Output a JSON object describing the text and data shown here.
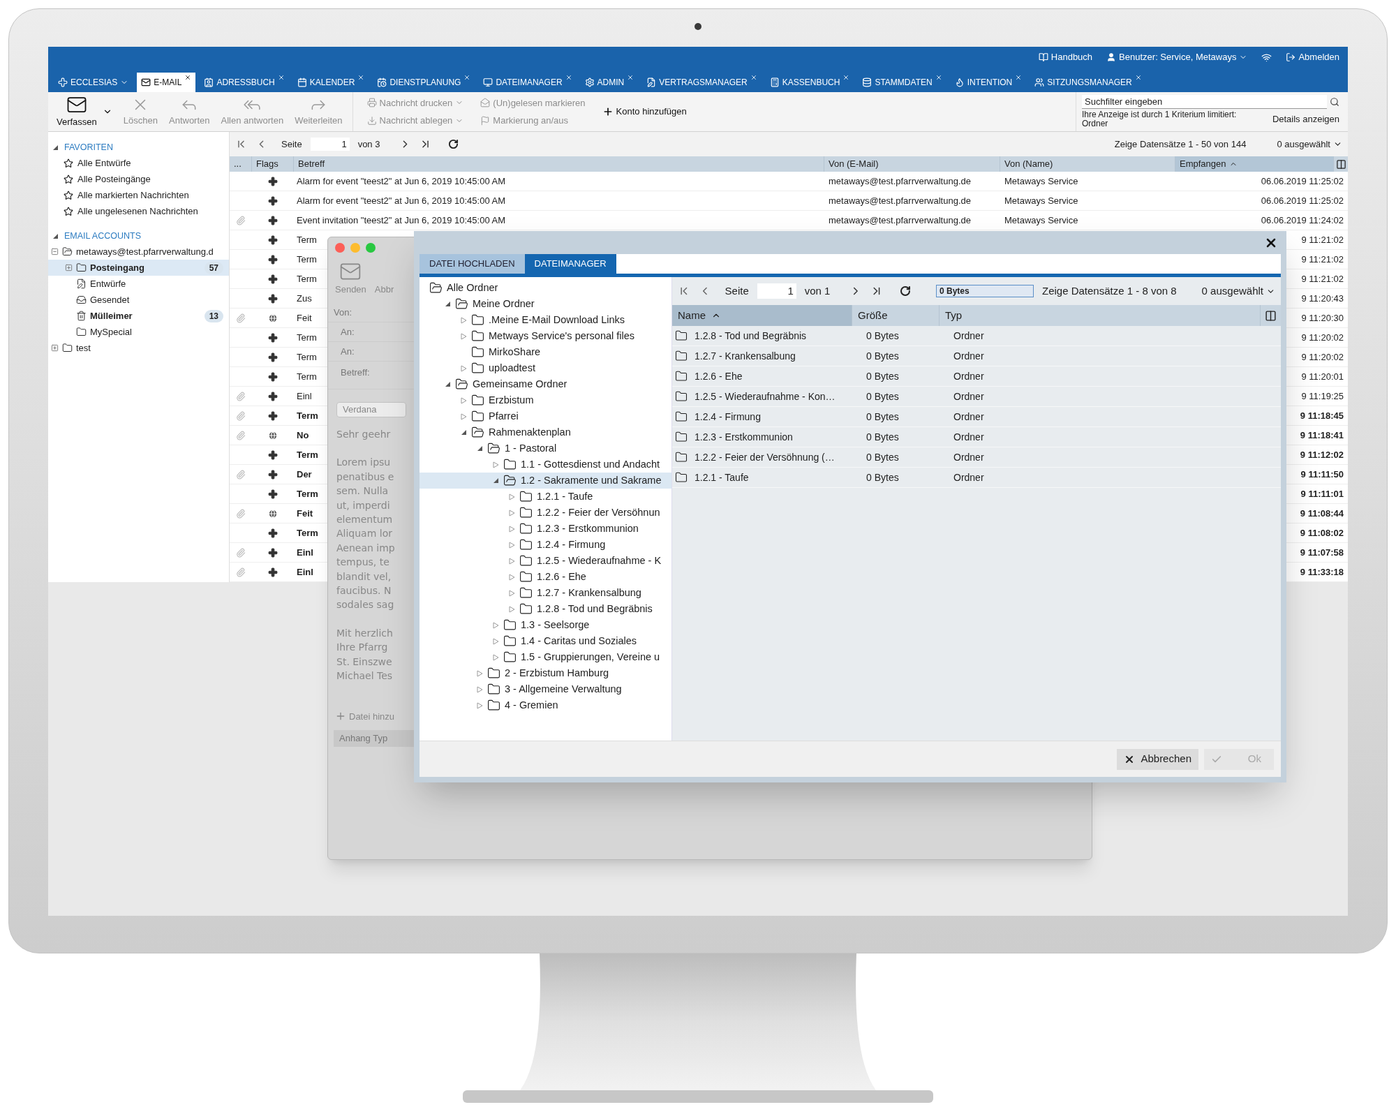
{
  "top_bar": {
    "user_links": [
      {
        "kind": "manual",
        "label": "Handbuch"
      },
      {
        "kind": "user",
        "label": "Benutzer: Service, Metaways"
      },
      {
        "kind": "logout",
        "label": "Abmelden"
      }
    ],
    "tabs": [
      {
        "kind": "menu",
        "label": "ECCLESIAS",
        "selected": false
      },
      {
        "kind": "app",
        "label": "E-MAIL",
        "selected": true
      },
      {
        "kind": "app",
        "label": "ADRESSBUCH",
        "selected": false
      },
      {
        "kind": "app",
        "label": "KALENDER",
        "selected": false
      },
      {
        "kind": "app",
        "label": "DIENSTPLANUNG",
        "selected": false
      },
      {
        "kind": "app",
        "label": "DATEIMANAGER",
        "selected": false
      },
      {
        "kind": "app",
        "label": "ADMIN",
        "selected": false
      },
      {
        "kind": "app",
        "label": "VERTRAGSMANAGER",
        "selected": false
      },
      {
        "kind": "app",
        "label": "KASSENBUCH",
        "selected": false
      },
      {
        "kind": "app",
        "label": "STAMMDATEN",
        "selected": false
      },
      {
        "kind": "app",
        "label": "INTENTION",
        "selected": false
      },
      {
        "kind": "app",
        "label": "SITZUNGSMANAGER",
        "selected": false
      }
    ]
  },
  "toolbar": {
    "buttons": [
      {
        "label": "Verfassen",
        "disabled": false,
        "dropdown": true
      },
      {
        "label": "Löschen",
        "disabled": true,
        "dropdown": false
      },
      {
        "label": "Antworten",
        "disabled": true,
        "dropdown": false
      },
      {
        "label": "Allen antworten",
        "disabled": true,
        "dropdown": false
      },
      {
        "label": "Weiterleiten",
        "disabled": true,
        "dropdown": false
      }
    ],
    "action_columns": [
      {
        "items": [
          {
            "label": "Nachricht drucken",
            "disabled": true,
            "dropdown": true
          },
          {
            "label": "Nachricht ablegen",
            "disabled": true,
            "dropdown": true
          }
        ]
      },
      {
        "items": [
          {
            "label": "(Un)gelesen markieren",
            "disabled": true,
            "dropdown": false
          },
          {
            "label": "Markierung an/aus",
            "disabled": true,
            "dropdown": false
          }
        ]
      },
      {
        "items": [
          {
            "label": "Konto hinzufügen",
            "disabled": false,
            "dropdown": false
          }
        ]
      }
    ],
    "search": {
      "placeholder": "Suchfilter eingeben"
    },
    "filter_note": "Ihre Anzeige ist durch 1 Kriterium limitiert: Ordner",
    "details_button": "Details anzeigen"
  },
  "sidebar": {
    "favorites": {
      "title": "FAVORITEN",
      "expanded": true,
      "items": [
        {
          "label": "Alle Entwürfe"
        },
        {
          "label": "Alle Posteingänge"
        },
        {
          "label": "Alle markierten Nachrichten"
        },
        {
          "label": "Alle ungelesenen Nachrichten"
        }
      ]
    },
    "accounts": {
      "title": "EMAIL ACCOUNTS",
      "expanded": true,
      "tree": [
        {
          "kind": "account",
          "label": "metaways@test.pfarrverwaltung.d",
          "expanded": true,
          "selected": false,
          "unread": false,
          "children": [
            {
              "kind": "folder",
              "label": "Posteingang",
              "expanded": false,
              "selected": true,
              "unread": true,
              "count": "57"
            },
            {
              "kind": "drafts",
              "label": "Entwürfe",
              "selected": false,
              "unread": false
            },
            {
              "kind": "sent",
              "label": "Gesendet",
              "selected": false,
              "unread": false
            },
            {
              "kind": "trash",
              "label": "Mülleimer",
              "selected": false,
              "unread": true,
              "count": "13"
            },
            {
              "kind": "folder",
              "label": "MySpecial",
              "selected": false,
              "unread": false
            }
          ]
        },
        {
          "kind": "folder",
          "label": "test",
          "expanded": false,
          "selected": false,
          "unread": false
        }
      ]
    }
  },
  "mail_list": {
    "pager": {
      "page_label": "Seite",
      "page": "1",
      "of": "von 3",
      "summary": "Zeige Datensätze 1 - 50 von 144",
      "selection": "0 ausgewählt"
    },
    "columns": [
      {
        "label": "...",
        "sorted": false
      },
      {
        "label": "Flags",
        "sorted": false
      },
      {
        "label": "Betreff",
        "sorted": false
      },
      {
        "label": "Von (E-Mail)",
        "sorted": false
      },
      {
        "label": "Von (Name)",
        "sorted": false
      },
      {
        "label": "Empfangen",
        "sorted": true
      }
    ],
    "rows": [
      {
        "subject": "Alarm for event \"teest2\" at Jun 6, 2019 10:45:00 AM",
        "email": "metaways@test.pfarrverwaltung.de",
        "name": "Metaways Service",
        "received": "06.06.2019 11:25:02",
        "unread": false,
        "attachment": false,
        "kind": "cross"
      },
      {
        "subject": "Alarm for event \"teest2\" at Jun 6, 2019 10:45:00 AM",
        "email": "metaways@test.pfarrverwaltung.de",
        "name": "Metaways Service",
        "received": "06.06.2019 11:25:02",
        "unread": false,
        "attachment": false,
        "kind": "cross"
      },
      {
        "subject": "Event invitation \"teest2\" at Jun 6, 2019 10:45:00 AM",
        "email": "metaways@test.pfarrverwaltung.de",
        "name": "Metaways Service",
        "received": "06.06.2019 11:24:02",
        "unread": false,
        "attachment": true,
        "kind": "cross"
      },
      {
        "subject": "Term",
        "received": "9 11:21:02",
        "unread": false,
        "attachment": false,
        "kind": "cross"
      },
      {
        "subject": "Term",
        "received": "9 11:21:02",
        "unread": false,
        "attachment": false,
        "kind": "cross"
      },
      {
        "subject": "Term",
        "received": "9 11:21:02",
        "unread": false,
        "attachment": false,
        "kind": "cross"
      },
      {
        "subject": "Zus",
        "received": "9 11:20:43",
        "unread": false,
        "attachment": false,
        "kind": "cross"
      },
      {
        "subject": "Feit",
        "received": "9 11:20:30",
        "unread": false,
        "attachment": true,
        "kind": "globe"
      },
      {
        "subject": "Term",
        "received": "9 11:20:02",
        "unread": false,
        "attachment": false,
        "kind": "cross"
      },
      {
        "subject": "Term",
        "received": "9 11:20:02",
        "unread": false,
        "attachment": false,
        "kind": "cross"
      },
      {
        "subject": "Term",
        "received": "9 11:20:01",
        "unread": false,
        "attachment": false,
        "kind": "cross"
      },
      {
        "subject": "Einl",
        "received": "9 11:19:25",
        "unread": false,
        "attachment": true,
        "kind": "cross"
      },
      {
        "subject": "Term",
        "received": "9 11:18:45",
        "unread": true,
        "attachment": true,
        "kind": "cross"
      },
      {
        "subject": "No",
        "received": "9 11:18:41",
        "unread": true,
        "attachment": true,
        "kind": "globe"
      },
      {
        "subject": "Term",
        "received": "9 11:12:02",
        "unread": true,
        "attachment": false,
        "kind": "cross"
      },
      {
        "subject": "Der",
        "received": "9 11:11:50",
        "unread": true,
        "attachment": true,
        "kind": "cross"
      },
      {
        "subject": "Term",
        "received": "9 11:11:01",
        "unread": true,
        "attachment": false,
        "kind": "cross"
      },
      {
        "subject": "Feit",
        "received": "9 11:08:44",
        "unread": true,
        "attachment": true,
        "kind": "globe"
      },
      {
        "subject": "Term",
        "received": "9 11:08:02",
        "unread": true,
        "attachment": false,
        "kind": "cross"
      },
      {
        "subject": "Einl",
        "received": "9 11:07:58",
        "unread": true,
        "attachment": true,
        "kind": "cross"
      },
      {
        "subject": "Einl",
        "received": "9 11:33:18",
        "unread": true,
        "attachment": true,
        "kind": "cross"
      }
    ]
  },
  "compose": {
    "buttons": [
      {
        "label": "Senden"
      },
      {
        "label": "Abbr"
      }
    ],
    "fields": [
      "Von:",
      "An:",
      "An:",
      "Betreff:"
    ],
    "font": "Verdana",
    "body": [
      [
        "Sehr geehr"
      ],
      [
        "Lorem ipsu",
        "penatibus e",
        "sem. Nulla",
        "ut, imperdi",
        "elementum",
        "Aliquam lor",
        "Aenean imp",
        "tempus, te",
        "blandit vel,",
        "faucibus. N",
        "sodales sag"
      ],
      [
        "Mit herzlich",
        "Ihre Pfarrg",
        "St. Einszwe",
        "Michael Tes"
      ]
    ],
    "attach_button": "Datei hinzu",
    "attach_header": "Anhang Typ"
  },
  "dialog": {
    "tabs": [
      {
        "label": "DATEI HOCHLADEN",
        "selected": false
      },
      {
        "label": "DATEIMANAGER",
        "selected": true
      }
    ],
    "tree": {
      "root": {
        "label": "Alle Ordner",
        "expanded": true
      },
      "children": [
        {
          "label": "Meine Ordner",
          "expanded": true,
          "selected": false,
          "children": [
            {
              "label": ".Meine E-Mail Download Links",
              "expanded": false,
              "selected": false
            },
            {
              "label": "Metways Service's personal files",
              "expanded": false,
              "selected": false
            },
            {
              "label": "MirkoShare",
              "selected": false
            },
            {
              "label": "uploadtest",
              "expanded": false,
              "selected": false
            }
          ]
        },
        {
          "label": "Gemeinsame Ordner",
          "expanded": true,
          "selected": false,
          "children": [
            {
              "label": "Erzbistum",
              "expanded": false,
              "selected": false
            },
            {
              "label": "Pfarrei",
              "expanded": false,
              "selected": false
            },
            {
              "label": "Rahmenaktenplan",
              "expanded": true,
              "selected": false,
              "children": [
                {
                  "label": "1 - Pastoral",
                  "expanded": true,
                  "selected": false,
                  "children": [
                    {
                      "label": "1.1 - Gottesdienst und Andacht",
                      "expanded": false,
                      "selected": false
                    },
                    {
                      "label": "1.2 - Sakramente und Sakrame",
                      "expanded": true,
                      "selected": true,
                      "children": [
                        {
                          "label": "1.2.1 - Taufe",
                          "expanded": false,
                          "selected": false
                        },
                        {
                          "label": "1.2.2 - Feier der Versöhnun",
                          "expanded": false,
                          "selected": false
                        },
                        {
                          "label": "1.2.3 - Erstkommunion",
                          "expanded": false,
                          "selected": false
                        },
                        {
                          "label": "1.2.4 - Firmung",
                          "expanded": false,
                          "selected": false
                        },
                        {
                          "label": "1.2.5 - Wiederaufnahme - K",
                          "expanded": false,
                          "selected": false
                        },
                        {
                          "label": "1.2.6 - Ehe",
                          "expanded": false,
                          "selected": false
                        },
                        {
                          "label": "1.2.7 - Krankensalbung",
                          "expanded": false,
                          "selected": false
                        },
                        {
                          "label": "1.2.8 - Tod und Begräbnis",
                          "expanded": false,
                          "selected": false
                        }
                      ]
                    },
                    {
                      "label": "1.3 - Seelsorge",
                      "expanded": false,
                      "selected": false
                    },
                    {
                      "label": "1.4 - Caritas und Soziales",
                      "expanded": false,
                      "selected": false
                    },
                    {
                      "label": "1.5 - Gruppierungen, Vereine u",
                      "expanded": false,
                      "selected": false
                    }
                  ]
                },
                {
                  "label": "2 - Erzbistum Hamburg",
                  "expanded": false,
                  "selected": false
                },
                {
                  "label": "3 - Allgemeine Verwaltung",
                  "expanded": false,
                  "selected": false
                },
                {
                  "label": "4 - Gremien",
                  "expanded": false,
                  "selected": false
                }
              ]
            }
          ]
        }
      ]
    },
    "pager": {
      "page_label": "Seite",
      "page": "1",
      "of": "von 1",
      "size": "0 Bytes",
      "summary": "Zeige Datensätze 1 - 8 von 8",
      "selection": "0 ausgewählt"
    },
    "columns": [
      {
        "label": "Name",
        "sorted": true
      },
      {
        "label": "Größe",
        "sorted": false
      },
      {
        "label": "Typ",
        "sorted": false
      }
    ],
    "files": [
      {
        "name": "1.2.8 - Tod und Begräbnis",
        "size": "0 Bytes",
        "type": "Ordner"
      },
      {
        "name": "1.2.7 - Krankensalbung",
        "size": "0 Bytes",
        "type": "Ordner"
      },
      {
        "name": "1.2.6 - Ehe",
        "size": "0 Bytes",
        "type": "Ordner"
      },
      {
        "name": "1.2.5 - Wiederaufnahme - Kon…",
        "size": "0 Bytes",
        "type": "Ordner"
      },
      {
        "name": "1.2.4 - Firmung",
        "size": "0 Bytes",
        "type": "Ordner"
      },
      {
        "name": "1.2.3 - Erstkommunion",
        "size": "0 Bytes",
        "type": "Ordner"
      },
      {
        "name": "1.2.2 - Feier der Versöhnung (…",
        "size": "0 Bytes",
        "type": "Ordner"
      },
      {
        "name": "1.2.1 - Taufe",
        "size": "0 Bytes",
        "type": "Ordner"
      }
    ],
    "buttons": [
      {
        "kind": "cancel",
        "label": "Abbrechen",
        "disabled": false
      },
      {
        "kind": "ok",
        "label": "Ok",
        "disabled": true
      }
    ]
  }
}
